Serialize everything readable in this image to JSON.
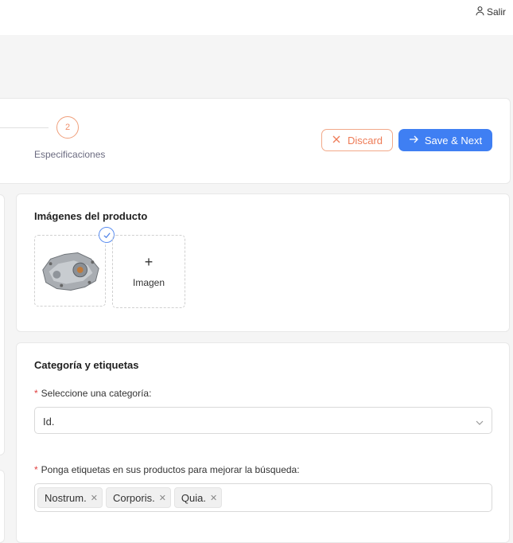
{
  "header": {
    "logout_label": "Salir"
  },
  "steps": {
    "step2_number": "2",
    "step2_label": "Especificaciones"
  },
  "actions": {
    "discard_label": "Discard",
    "save_label": "Save & Next"
  },
  "images": {
    "title": "Imágenes del producto",
    "add_label": "Imagen"
  },
  "category": {
    "title": "Categoría y etiquetas",
    "select_label": "Seleccione una categoría:",
    "select_value": "Id.",
    "tags_label": "Ponga etiquetas en sus productos para mejorar la búsqueda:",
    "tags": [
      "Nostrum.",
      "Corporis.",
      "Quia."
    ]
  },
  "colors": {
    "primary": "#3f7ff3",
    "discard": "#ee7b56",
    "required": "#e04040"
  }
}
